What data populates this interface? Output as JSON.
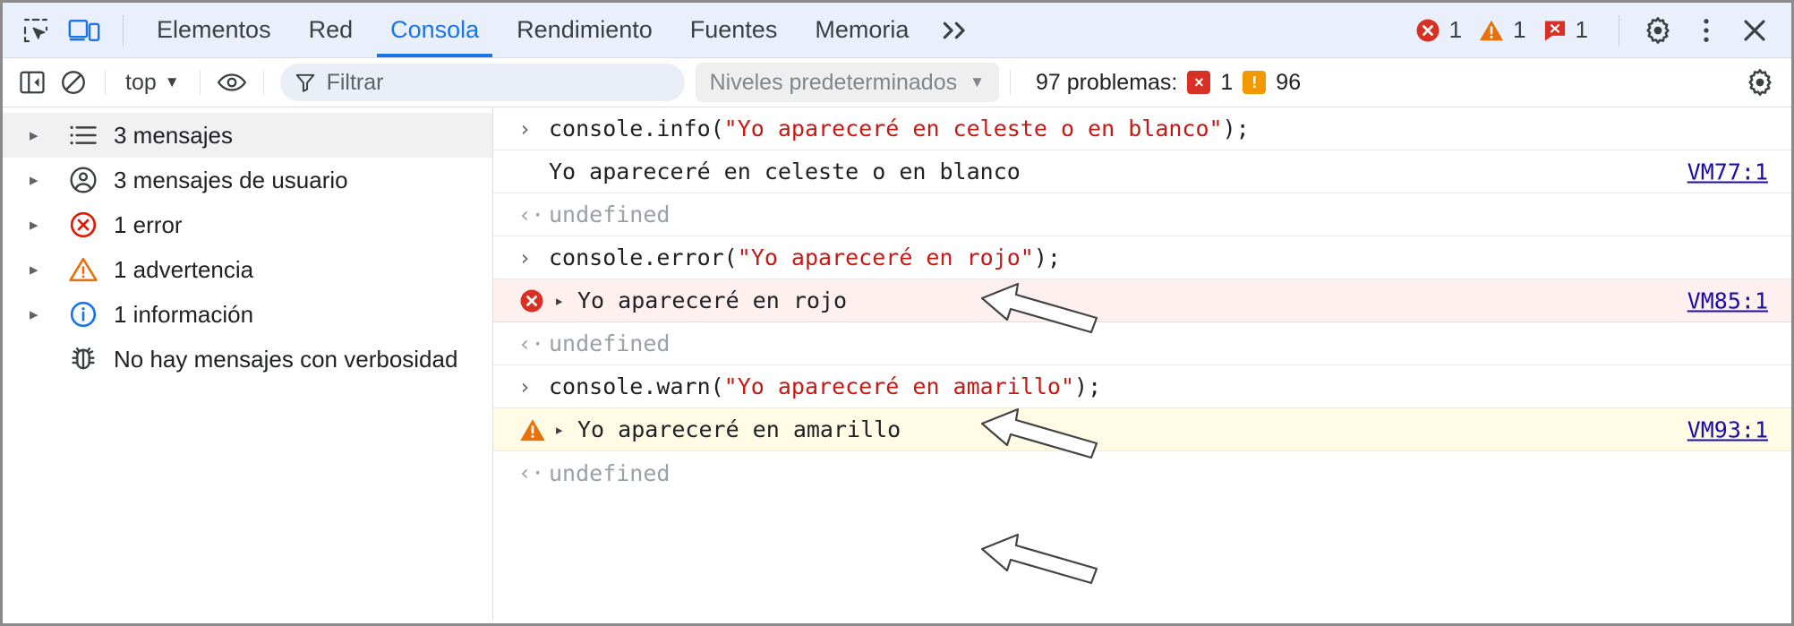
{
  "tabbar": {
    "inspect_icon": "inspect-element-icon",
    "device_icon": "device-toolbar-icon",
    "tabs": [
      {
        "label": "Elementos",
        "active": false
      },
      {
        "label": "Red",
        "active": false
      },
      {
        "label": "Consola",
        "active": true
      },
      {
        "label": "Rendimiento",
        "active": false
      },
      {
        "label": "Fuentes",
        "active": false
      },
      {
        "label": "Memoria",
        "active": false
      }
    ],
    "more_label": "»",
    "counters": [
      {
        "type": "error",
        "count": "1"
      },
      {
        "type": "warning",
        "count": "1"
      },
      {
        "type": "issue",
        "count": "1"
      }
    ],
    "settings_label": "gear-icon",
    "menu_label": "kebab-menu-icon",
    "close_label": "close-icon"
  },
  "consolebar": {
    "sidebar_toggle": "show-console-sidebar-icon",
    "clear_label": "clear-console-icon",
    "context": "top",
    "context_caret": "▼",
    "eye_label": "live-expression-icon",
    "filter_placeholder": "Filtrar",
    "filter_value": "",
    "levels_label": "Niveles predeterminados",
    "levels_caret": "▼",
    "problems_text": "97 problemas:",
    "problems_errors": "1",
    "problems_warnings": "96",
    "error_badge_glyph": "×",
    "warn_badge_glyph": "!",
    "settings_label": "console-settings-gear-icon"
  },
  "sidebar": {
    "items": [
      {
        "label": "3 mensajes",
        "icon": "list-icon",
        "expandable": true,
        "selected": true
      },
      {
        "label": "3 mensajes de usuario",
        "icon": "user-icon",
        "expandable": true,
        "selected": false
      },
      {
        "label": "1 error",
        "icon": "error-circle-icon",
        "expandable": true,
        "selected": false
      },
      {
        "label": "1 advertencia",
        "icon": "warning-triangle-icon",
        "expandable": true,
        "selected": false
      },
      {
        "label": "1 información",
        "icon": "info-circle-icon",
        "expandable": true,
        "selected": false
      },
      {
        "label": "No hay mensajes con verbosidad",
        "icon": "bug-icon",
        "expandable": false,
        "selected": false
      }
    ]
  },
  "console": {
    "prompt_glyph": "›",
    "output_glyph": "‹·",
    "expand_glyph": "▸",
    "lines": [
      {
        "kind": "input",
        "code_pre": "console.info(",
        "code_str": "\"Yo apareceré en celeste o en blanco\"",
        "code_post": ");"
      },
      {
        "kind": "message",
        "level": "info",
        "text": "Yo apareceré en celeste o en blanco",
        "source": "VM77:1"
      },
      {
        "kind": "result",
        "text": "undefined"
      },
      {
        "kind": "input",
        "code_pre": "console.error(",
        "code_str": "\"Yo apareceré en rojo\"",
        "code_post": ");"
      },
      {
        "kind": "message",
        "level": "error",
        "text": "Yo apareceré en rojo",
        "source": "VM85:1"
      },
      {
        "kind": "result",
        "text": "undefined"
      },
      {
        "kind": "input",
        "code_pre": "console.warn(",
        "code_str": "\"Yo apareceré en amarillo\"",
        "code_post": ");"
      },
      {
        "kind": "message",
        "level": "warning",
        "text": "Yo apareceré en amarillo",
        "source": "VM93:1"
      },
      {
        "kind": "result",
        "text": "undefined"
      }
    ]
  },
  "colors": {
    "accent": "#1a73e8",
    "error": "#d93025",
    "warning": "#e8710a",
    "info": "#1a73e8",
    "string": "#c41a16",
    "link": "#1a0dab",
    "error_row_bg": "#fff0f0",
    "warning_row_bg": "#fffbe5",
    "tabbar_bg": "#eaf0fb"
  }
}
